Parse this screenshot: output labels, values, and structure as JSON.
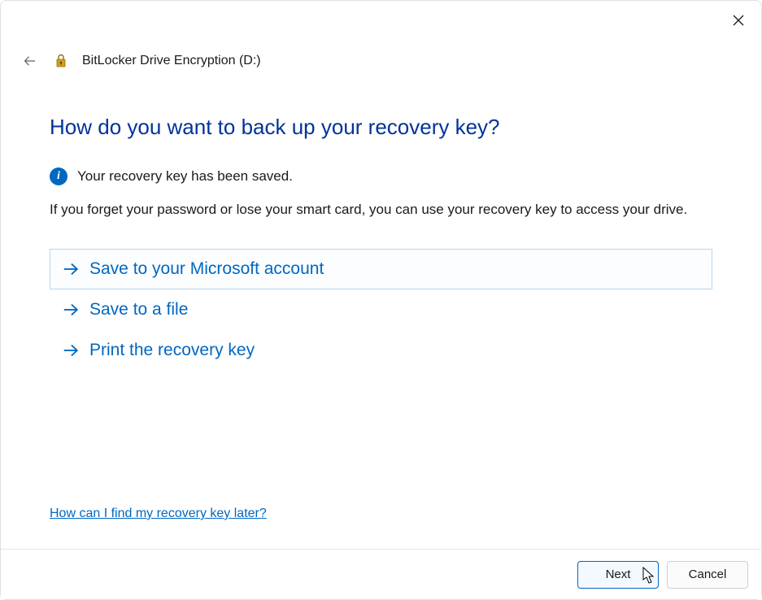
{
  "window": {
    "app_title": "BitLocker Drive Encryption (D:)"
  },
  "heading": "How do you want to back up your recovery key?",
  "info": {
    "icon_char": "i",
    "text": "Your recovery key has been saved."
  },
  "description": "If you forget your password or lose your smart card, you can use your recovery key to access your drive.",
  "options": [
    {
      "label": "Save to your Microsoft account",
      "selected": true
    },
    {
      "label": "Save to a file",
      "selected": false
    },
    {
      "label": "Print the recovery key",
      "selected": false
    }
  ],
  "help_link": "How can I find my recovery key later?",
  "footer": {
    "next_label": "Next",
    "cancel_label": "Cancel"
  }
}
